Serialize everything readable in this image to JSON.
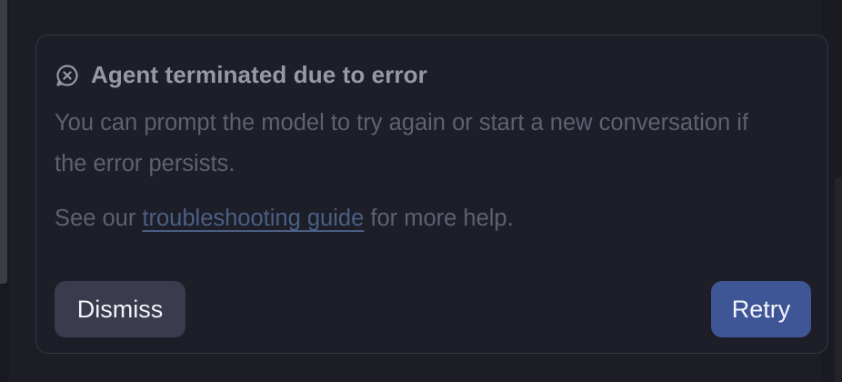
{
  "error_card": {
    "icon": "chat-bubble-x-icon",
    "title": "Agent terminated due to error",
    "message": "You can prompt the model to try again or start a new conversation if the error persists.",
    "help_prefix": "See our",
    "help_link": "troubleshooting guide",
    "help_suffix": "for more help."
  },
  "actions": {
    "dismiss_label": "Dismiss",
    "retry_label": "Retry"
  },
  "colors": {
    "background": "#1c1d25",
    "card_border": "#34363f",
    "title": "#9899a7",
    "body_text": "#5f6172",
    "link": "#4a5f84",
    "dismiss_bg": "#3a3b4c",
    "retry_bg": "#3f5696"
  }
}
